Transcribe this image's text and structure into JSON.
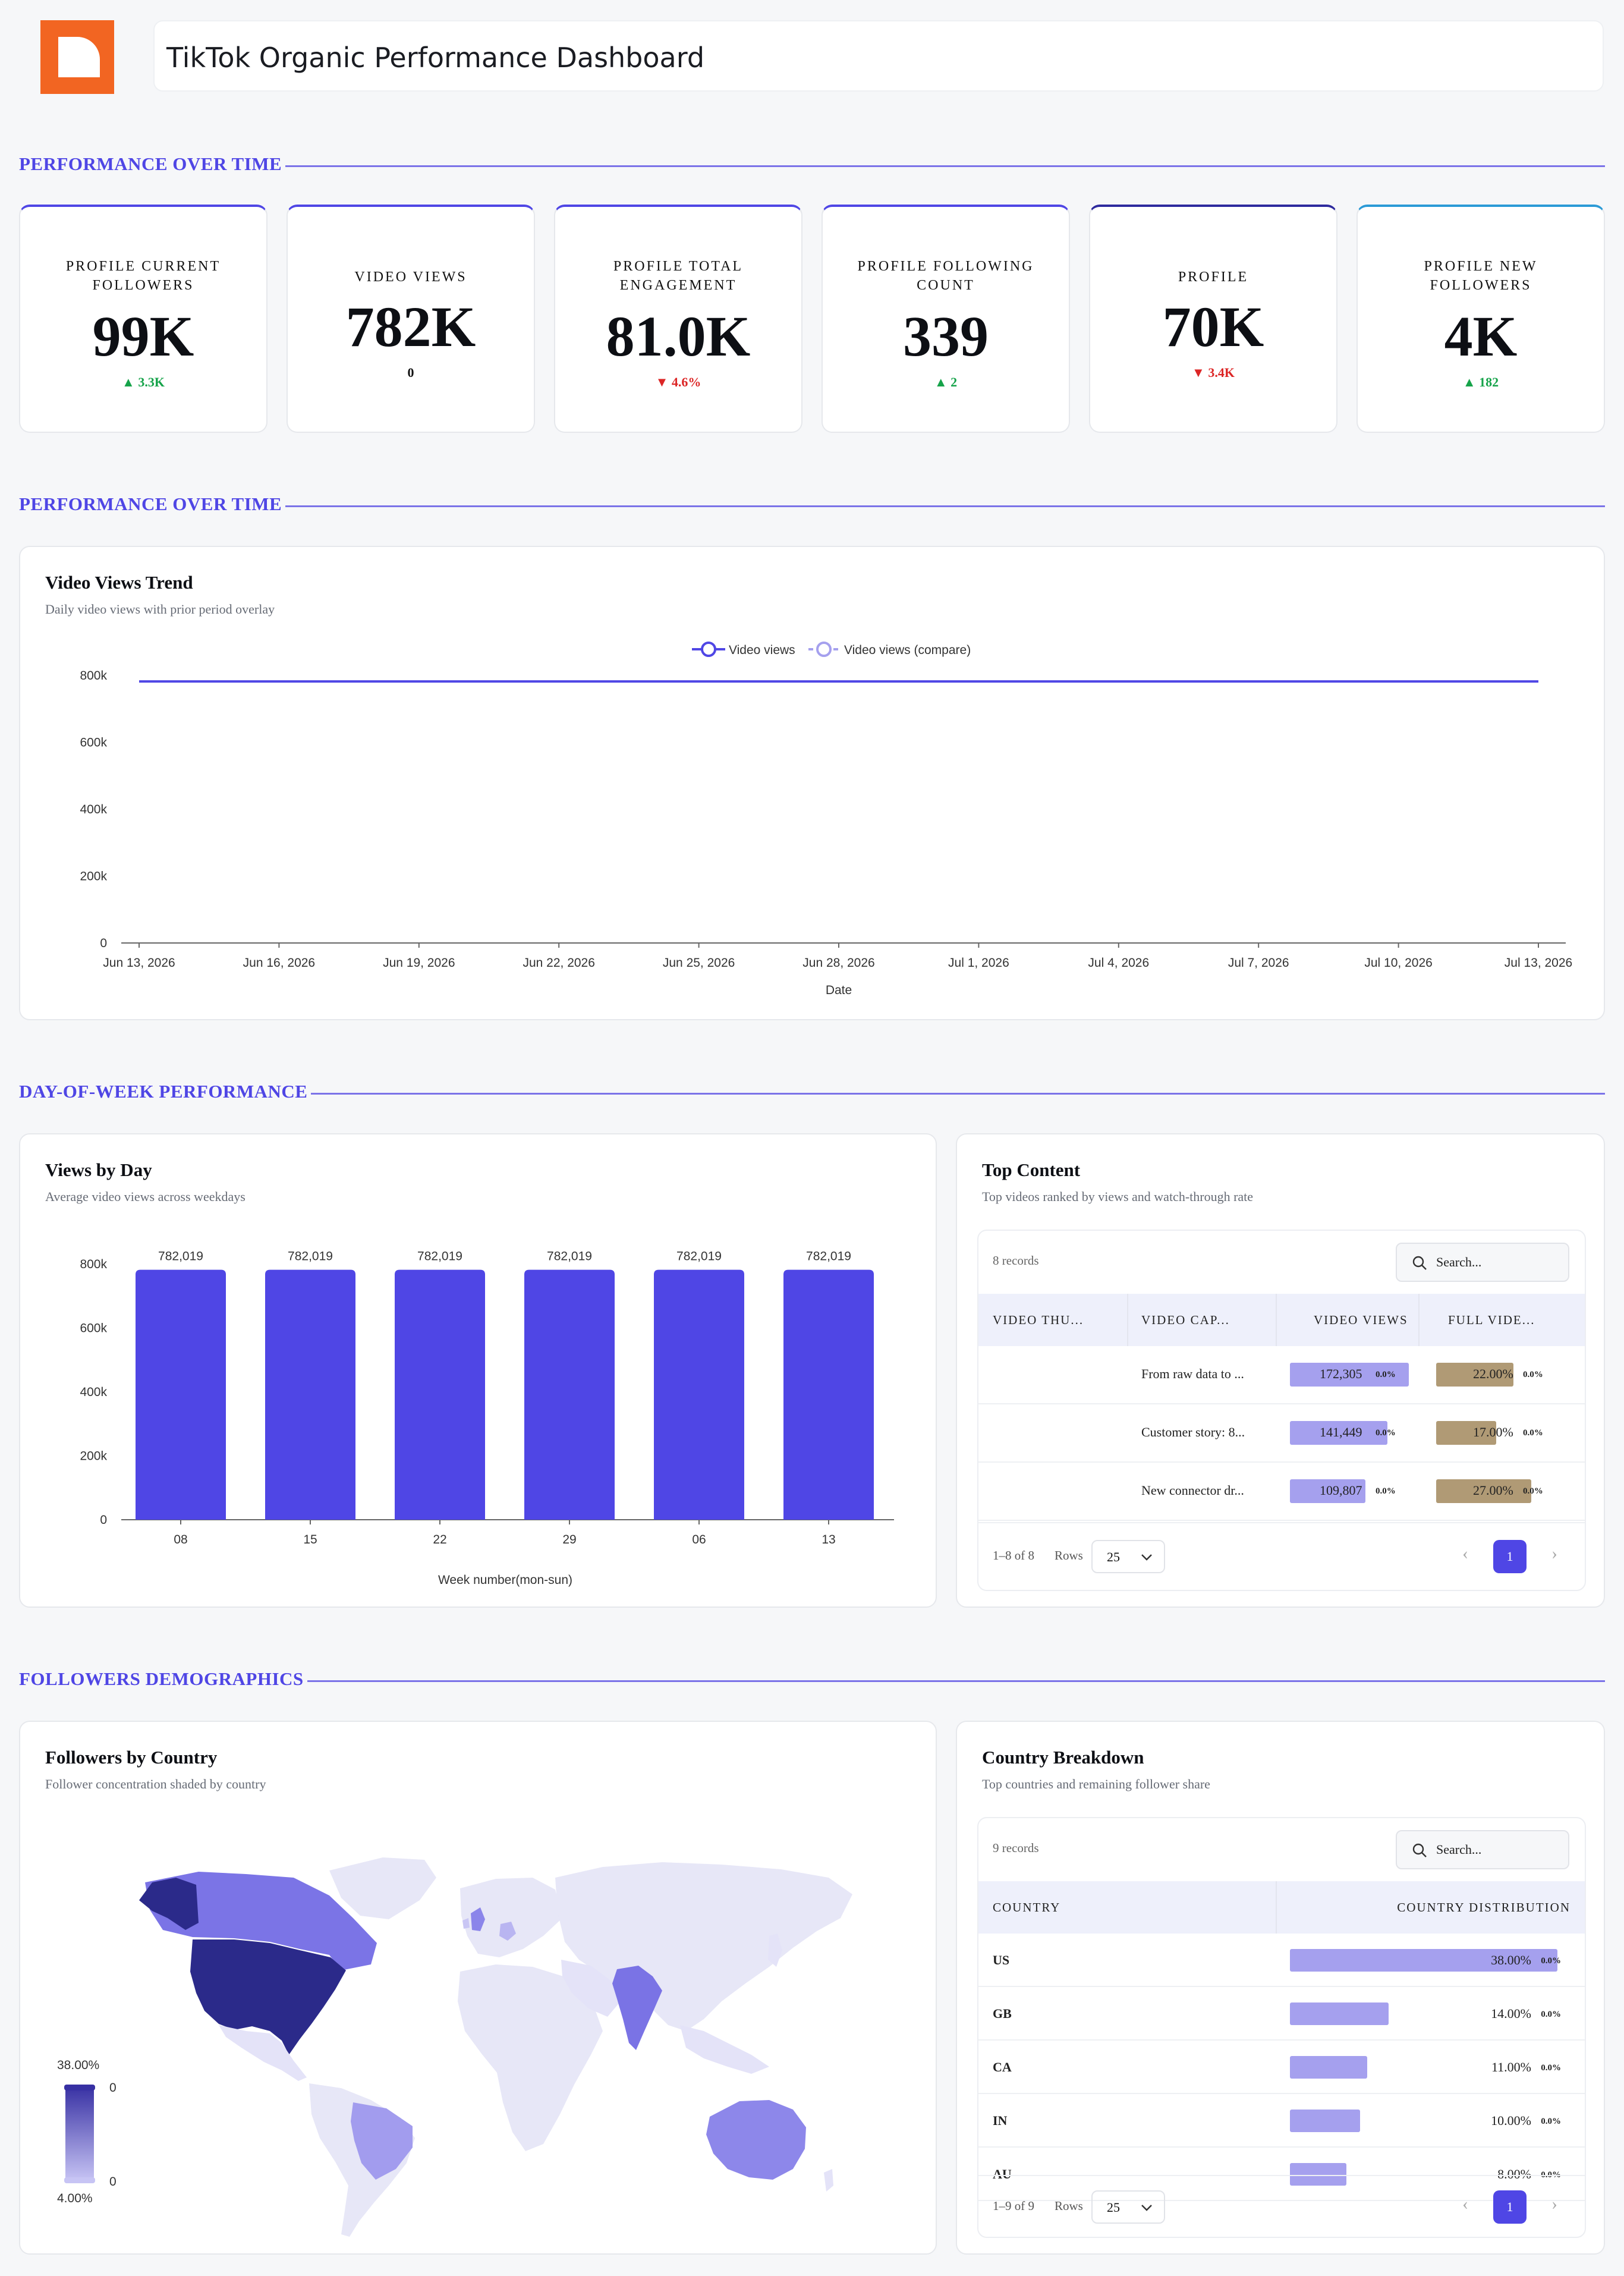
{
  "header": {
    "title": "TikTok Organic Performance Dashboard"
  },
  "sections": {
    "s1": "PERFORMANCE OVER TIME",
    "s2": "PERFORMANCE OVER TIME",
    "s3": "DAY-OF-WEEK PERFORMANCE",
    "s4": "FOLLOWERS DEMOGRAPHICS"
  },
  "kpis": [
    {
      "label": "PROFILE CURRENT FOLLOWERS",
      "value": "99K",
      "delta": "3.3K",
      "dir": "up"
    },
    {
      "label": "VIDEO VIEWS",
      "value": "782K",
      "delta": "0",
      "dir": "neutral"
    },
    {
      "label": "PROFILE TOTAL ENGAGEMENT",
      "value": "81.0K",
      "delta": "4.6%",
      "dir": "down"
    },
    {
      "label": "PROFILE FOLLOWING COUNT",
      "value": "339",
      "delta": "2",
      "dir": "up"
    },
    {
      "label": "PROFILE",
      "value": "70K",
      "delta": "3.4K",
      "dir": "down"
    },
    {
      "label": "PROFILE NEW FOLLOWERS",
      "value": "4K",
      "delta": "182",
      "dir": "up"
    }
  ],
  "trend": {
    "title": "Video Views Trend",
    "subtitle": "Daily video views with prior period overlay"
  },
  "views_by_day": {
    "title": "Views by Day",
    "subtitle": "Average video views across weekdays"
  },
  "top_content": {
    "title": "Top Content",
    "subtitle": "Top videos ranked by views and watch-through rate",
    "records": "8 records",
    "search_placeholder": "Search...",
    "columns": [
      "VIDEO THU...",
      "VIDEO CAP...",
      "VIDEO VIEWS",
      "FULL VIDE..."
    ],
    "rows": [
      {
        "caption": "From raw data to ...",
        "views": "172,305",
        "views_share": 0.22,
        "views_delta": "0.0%",
        "full": "22.00%",
        "full_share": 0.22,
        "full_delta": "0.0%"
      },
      {
        "caption": "Customer story: 8...",
        "views": "141,449",
        "views_share": 0.18,
        "views_delta": "0.0%",
        "full": "17.00%",
        "full_share": 0.17,
        "full_delta": "0.0%"
      },
      {
        "caption": "New connector dr...",
        "views": "109,807",
        "views_share": 0.14,
        "views_delta": "0.0%",
        "full": "27.00%",
        "full_share": 0.27,
        "full_delta": "0.0%"
      }
    ],
    "footer": "1–8 of 8",
    "rows_label": "Rows",
    "rows_value": "25",
    "page": "1",
    "prev_icon": "‹",
    "next_icon": "›"
  },
  "followers_map": {
    "title": "Followers by Country",
    "subtitle": "Follower concentration shaded by country",
    "legend_max": "38.00%",
    "legend_min": "4.00%",
    "legend_tick_top": "0",
    "legend_tick_bottom": "0"
  },
  "country": {
    "title": "Country Breakdown",
    "subtitle": "Top countries and remaining follower share",
    "records": "9 records",
    "search_placeholder": "Search...",
    "columns": [
      "COUNTRY",
      "COUNTRY DISTRIBUTION"
    ],
    "rows": [
      {
        "country": "US",
        "value": "38.00%",
        "share": 0.38,
        "delta": "0.0%"
      },
      {
        "country": "GB",
        "value": "14.00%",
        "share": 0.14,
        "delta": "0.0%"
      },
      {
        "country": "CA",
        "value": "11.00%",
        "share": 0.11,
        "delta": "0.0%"
      },
      {
        "country": "IN",
        "value": "10.00%",
        "share": 0.1,
        "delta": "0.0%"
      },
      {
        "country": "AU",
        "value": "8.00%",
        "share": 0.08,
        "delta": "0.0%"
      }
    ],
    "footer": "1–9 of 9",
    "rows_label": "Rows",
    "rows_value": "25",
    "page": "1",
    "prev_icon": "‹",
    "next_icon": "›"
  },
  "colors": {
    "accent": "#4f46e5",
    "bar_light": "#a5a0ee",
    "bar_tan": "#b09a75",
    "up": "#16a34a",
    "down": "#dc2626"
  },
  "chart_data": [
    {
      "type": "line",
      "title": "Video Views Trend",
      "xlabel": "Date",
      "ylabel": "",
      "x_ticks": [
        "Jun 13, 2026",
        "Jun 16, 2026",
        "Jun 19, 2026",
        "Jun 22, 2026",
        "Jun 25, 2026",
        "Jun 28, 2026",
        "Jul 1, 2026",
        "Jul 4, 2026",
        "Jul 7, 2026",
        "Jul 10, 2026",
        "Jul 13, 2026"
      ],
      "y_ticks": [
        "0",
        "200k",
        "400k",
        "600k",
        "800k"
      ],
      "ylim": [
        0,
        800000
      ],
      "legend": "top",
      "series": [
        {
          "name": "Video views",
          "x": [
            "Jun 13, 2026",
            "Jul 13, 2026"
          ],
          "values": [
            782019,
            782019
          ]
        },
        {
          "name": "Video views (compare)",
          "x": [],
          "values": []
        }
      ]
    },
    {
      "type": "bar",
      "title": "Views by Day",
      "xlabel": "Week number(mon-sun)",
      "ylabel": "",
      "categories": [
        "08",
        "15",
        "22",
        "29",
        "06",
        "13"
      ],
      "values": [
        782019,
        782019,
        782019,
        782019,
        782019,
        782019
      ],
      "labels": [
        "782,019",
        "782,019",
        "782,019",
        "782,019",
        "782,019",
        "782,019"
      ],
      "y_ticks": [
        "0",
        "200k",
        "400k",
        "600k",
        "800k"
      ],
      "ylim": [
        0,
        800000
      ]
    }
  ]
}
